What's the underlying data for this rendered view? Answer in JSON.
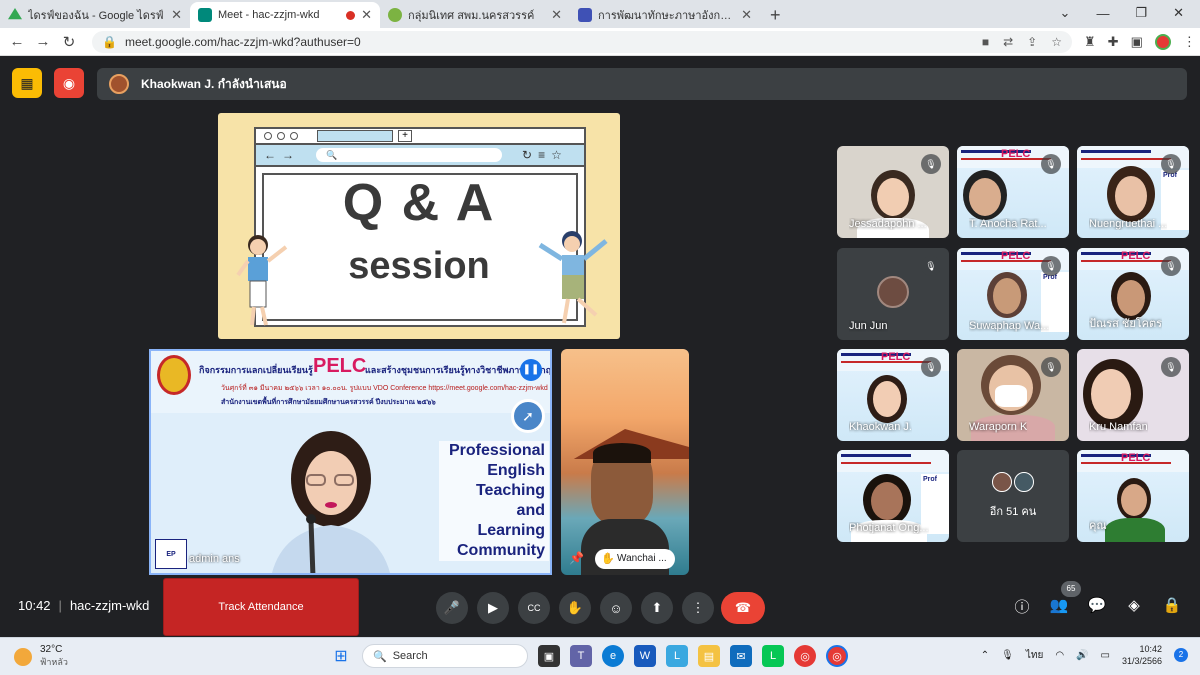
{
  "browser": {
    "tabs": [
      {
        "title": "ไดรฟ์ของฉัน - Google ไดรฟ์",
        "active": false,
        "favicon_color": "#34a853"
      },
      {
        "title": "Meet - hac-zzjm-wkd",
        "active": true,
        "favicon_color": "#00897b",
        "recording": true
      },
      {
        "title": "กลุ่มนิเทศ สพม.นครสวรรค์",
        "active": false,
        "favicon_color": "#7cb342"
      },
      {
        "title": "การพัฒนาทักษะภาษาอังกฤษ English",
        "active": false,
        "favicon_color": "#3f51b5"
      }
    ],
    "url": "meet.google.com/hac-zzjm-wkd?authuser=0"
  },
  "meet": {
    "presenter_banner": "Khaokwan J. กำลังนำเสนอ",
    "slide": {
      "line1": "Q & A",
      "line2": "session"
    },
    "presenter_tile": {
      "header": "กิจกรรมการแลกเปลี่ยนเรียนรู้",
      "header_mid": "PELC",
      "header_tail": "และสร้างชุมชนการเรียนรู้ทางวิชาชีพภาษาอังกฤษ",
      "date_line": "วันศุกร์ที่ ๓๑ มีนาคม ๒๕๖๖ เวลา ๑๐.๐๐น. รูปแบบ VDO Conference https://meet.google.com/hac-zzjm-wkd",
      "office_line": "สำนักงานเขตพื้นที่การศึกษามัธยมศึกษานครสวรรค์  ปีงบประมาณ ๒๕๖๖",
      "slogan": [
        "Professional",
        "English",
        "Teaching",
        "and",
        "Learning",
        "Community"
      ],
      "name": "admin ans",
      "corner_logo": "EP"
    },
    "side_tile": {
      "name": "Wanchai ..."
    },
    "participants": [
      {
        "name": "Jessadapohn ...",
        "muted": true
      },
      {
        "name": "T. Anocha Rat...",
        "muted": true
      },
      {
        "name": "Nuengruethai ...",
        "muted": true
      },
      {
        "name": "Jun Jun",
        "muted": true
      },
      {
        "name": "Suwaphap Wa...",
        "muted": true
      },
      {
        "name": "ปัณรส ชัยโคตร",
        "muted": true
      },
      {
        "name": "Khaokwan J.",
        "muted": true
      },
      {
        "name": "Waraporn K",
        "muted": true
      },
      {
        "name": "Kru Namfan",
        "muted": true
      },
      {
        "name": "Photjanat Ong...",
        "muted": true
      },
      {
        "name": "อีก 51 คน",
        "muted": false
      },
      {
        "name": "คุณ",
        "muted": false
      }
    ],
    "time": "10:42",
    "meeting_code": "hac-zzjm-wkd",
    "track_attendance": "Track Attendance",
    "participant_count": "65"
  },
  "taskbar": {
    "temp": "32°C",
    "weather": "ฟ้าหลัว",
    "search": "Search",
    "lang": "ไทย",
    "clock_time": "10:42",
    "clock_date": "31/3/2566",
    "notifications": "2"
  }
}
